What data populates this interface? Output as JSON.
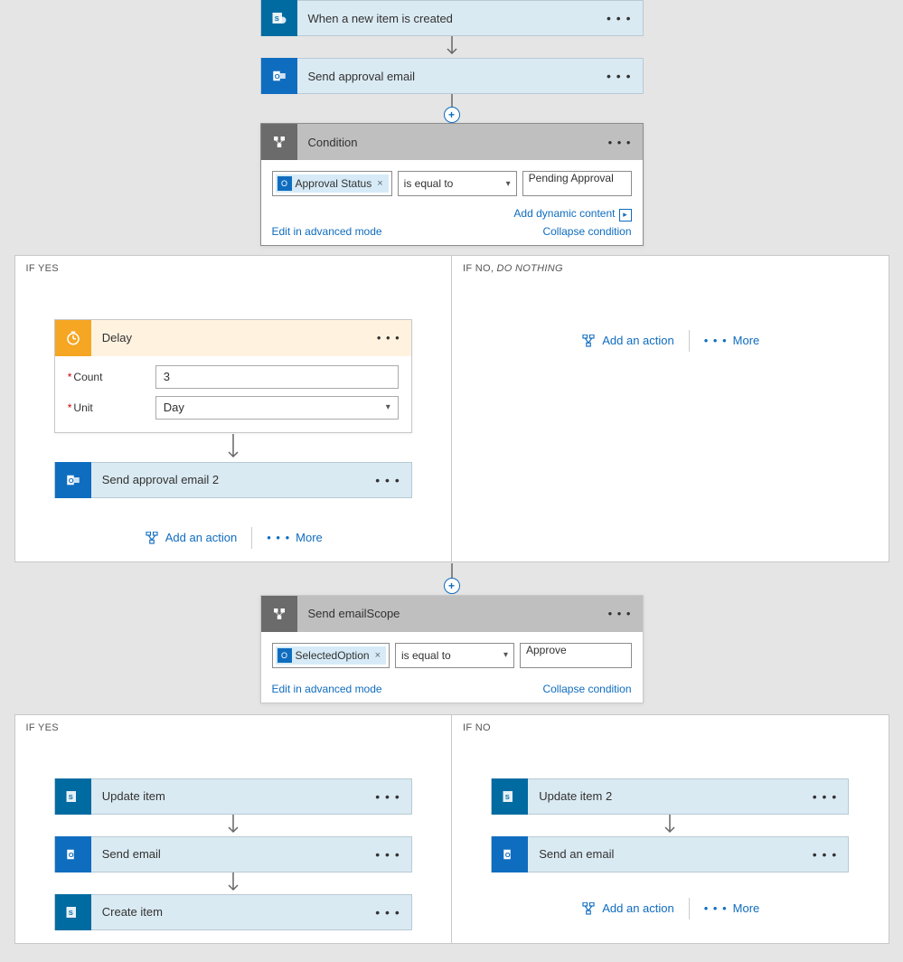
{
  "triggers": {
    "sharepoint_new_item": "When a new item is created",
    "send_approval": "Send approval email"
  },
  "condition1": {
    "title": "Condition",
    "token": "Approval Status",
    "operator": "is equal to",
    "value": "Pending Approval",
    "dynamic": "Add dynamic content",
    "edit_advanced": "Edit in advanced mode",
    "collapse": "Collapse condition"
  },
  "branch1": {
    "yes_label": "IF YES",
    "no_label": "IF NO, ",
    "no_em": "DO NOTHING",
    "delay": {
      "title": "Delay",
      "count_label": "Count",
      "count_value": "3",
      "unit_label": "Unit",
      "unit_value": "Day"
    },
    "send_approval2": "Send approval email 2"
  },
  "actions": {
    "add": "Add an action",
    "more": "More"
  },
  "condition2": {
    "title": "Send emailScope",
    "token": "SelectedOption",
    "operator": "is equal to",
    "value": "Approve",
    "edit_advanced": "Edit in advanced mode",
    "collapse": "Collapse condition"
  },
  "branch2": {
    "yes_label": "IF YES",
    "no_label": "IF NO",
    "yes_steps": {
      "update": "Update item",
      "send_email": "Send email",
      "create": "Create item"
    },
    "no_steps": {
      "update2": "Update item 2",
      "send_an_email": "Send an email"
    }
  }
}
